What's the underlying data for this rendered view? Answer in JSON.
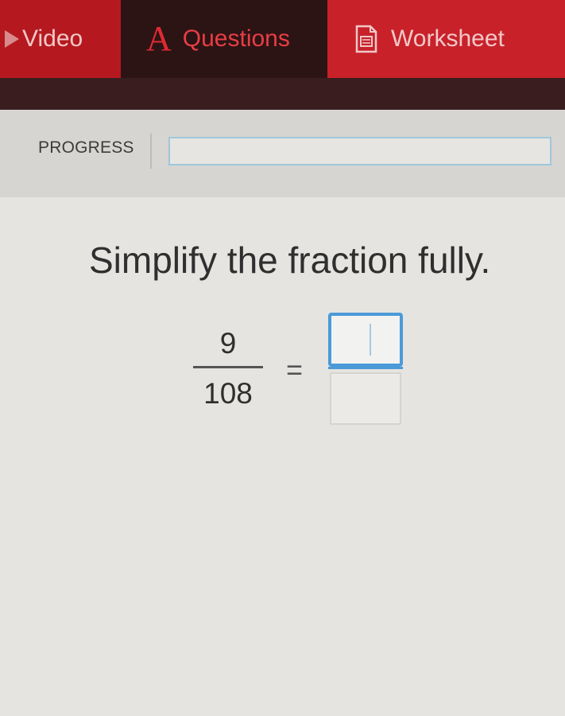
{
  "tabs": {
    "video": {
      "label": "Video",
      "icon": "play-icon"
    },
    "questions": {
      "label": "Questions",
      "icon": "letter-a-icon",
      "icon_glyph": "A",
      "active": true
    },
    "worksheet": {
      "label": "Worksheet",
      "icon": "worksheet-icon"
    }
  },
  "progress": {
    "label": "PROGRESS",
    "value": 0
  },
  "question": {
    "prompt": "Simplify the fraction fully.",
    "numerator": "9",
    "denominator": "108",
    "equals": "=",
    "answer_numerator": "",
    "answer_denominator": ""
  },
  "colors": {
    "brand_red": "#c8212a",
    "active_tab": "#2c1415",
    "input_focus": "#4b9ad8"
  }
}
